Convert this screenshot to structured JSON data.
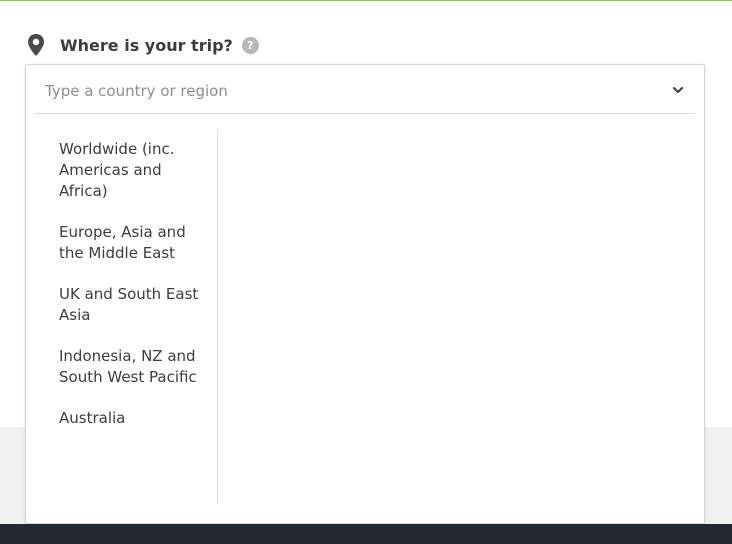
{
  "colors": {
    "accent_green": "#8dc63f",
    "footer_dark": "#242a33",
    "pin_grey": "#4a4a4a"
  },
  "question": {
    "label": "Where is your trip?",
    "help_glyph": "?",
    "icon": "map-pin-icon"
  },
  "search": {
    "placeholder": "Type a country or region",
    "value": "",
    "icon": "chevron-down-icon"
  },
  "regions": [
    {
      "label": "Worldwide (inc. Americas and Africa)"
    },
    {
      "label": "Europe, Asia and the Middle East"
    },
    {
      "label": "UK and South East Asia"
    },
    {
      "label": "Indonesia, NZ and South West Pacific"
    },
    {
      "label": "Australia"
    }
  ]
}
